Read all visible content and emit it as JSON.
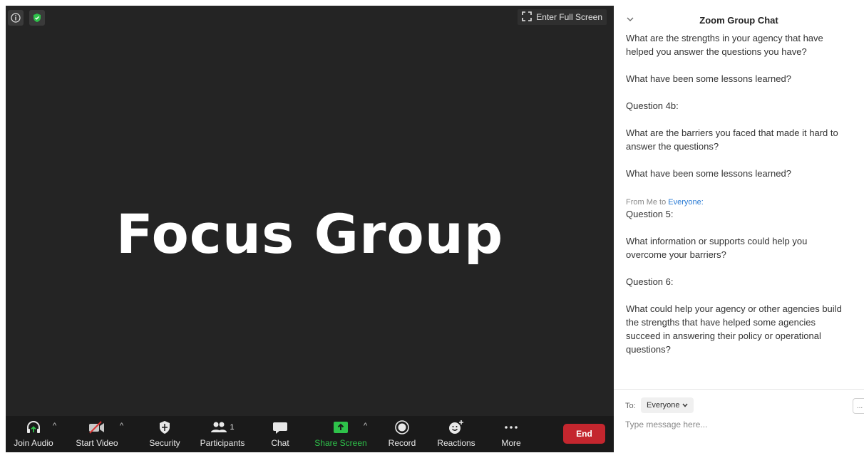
{
  "meeting": {
    "title": "Focus Group",
    "fullscreen_label": "Enter Full Screen",
    "icons": [
      "info-icon",
      "shield-check-icon",
      "fullscreen-icon"
    ]
  },
  "toolbar": {
    "join_audio": "Join Audio",
    "start_video": "Start Video",
    "security": "Security",
    "participants": "Participants",
    "participants_count": "1",
    "chat": "Chat",
    "share_screen": "Share Screen",
    "record": "Record",
    "reactions": "Reactions",
    "more": "More",
    "end": "End",
    "share_color": "#2ec24a",
    "end_color": "#c4262e"
  },
  "chat": {
    "title": "Zoom Group Chat",
    "messages": [
      "What are the strengths in your agency that have helped you answer the questions you have?",
      "What have been some lessons learned?",
      "Question 4b:",
      "What are the barriers you faced that made it hard to answer the questions?",
      "What have been some lessons learned?",
      "Question 5:",
      "What information or supports could help you overcome your barriers?",
      "Question 6:",
      "What could help your agency or other agencies build the strengths that have helped some agencies succeed in answering their policy or operational questions?"
    ],
    "sender_prefix": "From Me to",
    "sender_recipient": "Everyone:",
    "compose": {
      "to_label": "To:",
      "recipient": "Everyone",
      "placeholder": "Type message here...",
      "more_label": "..."
    }
  }
}
